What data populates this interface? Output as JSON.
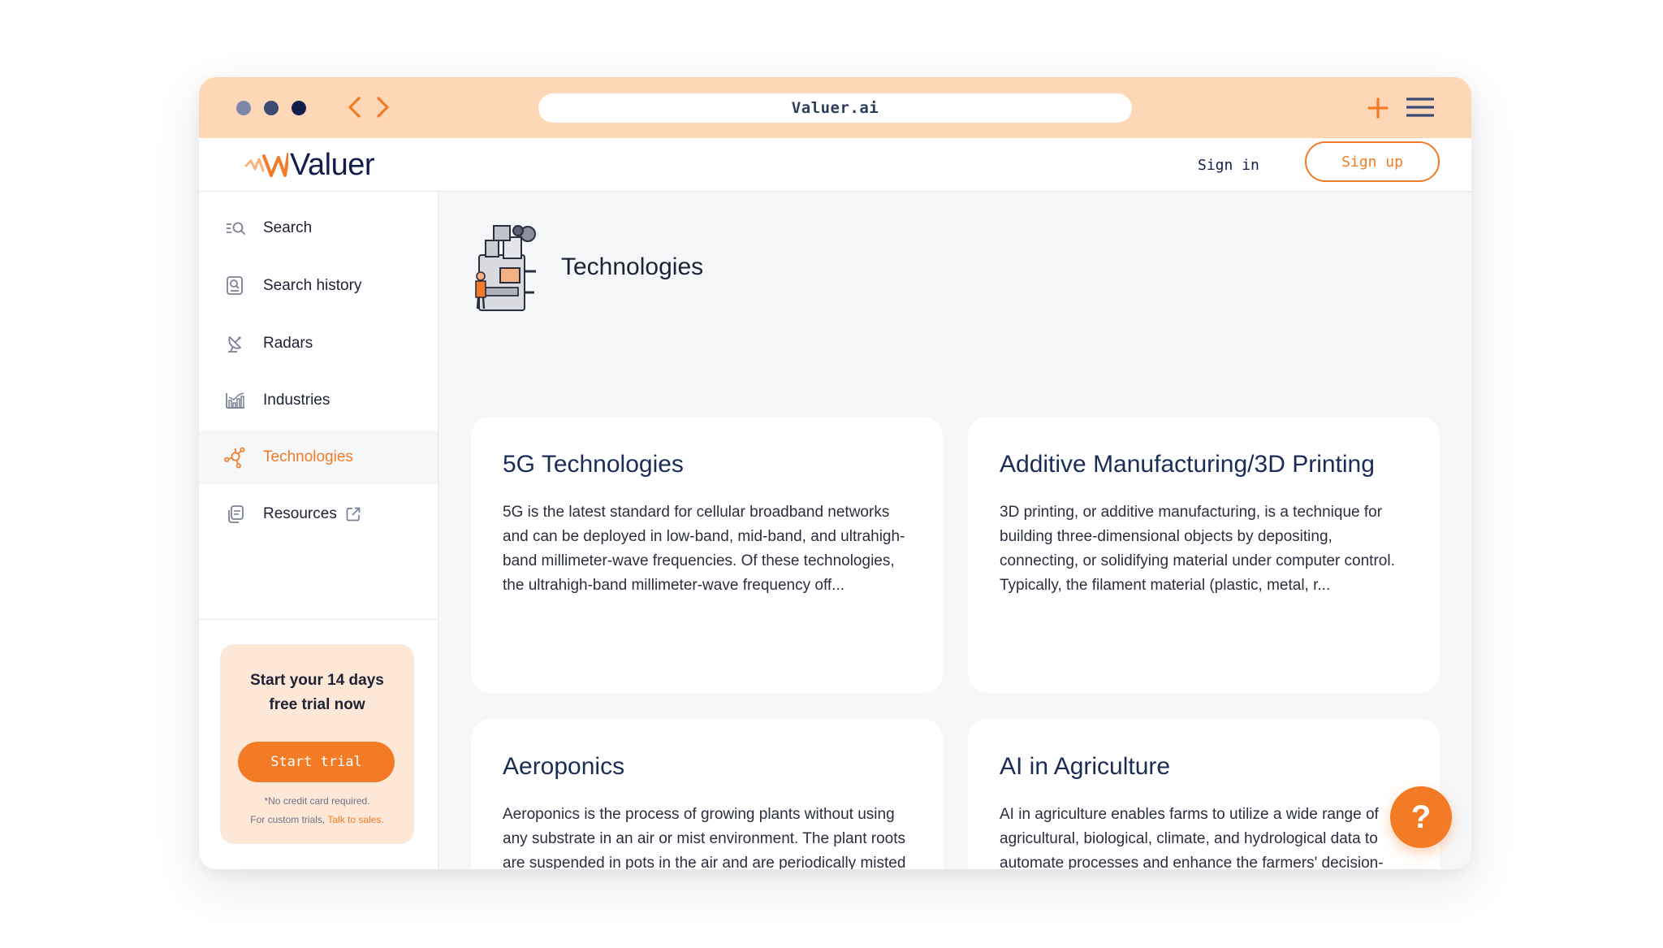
{
  "browser": {
    "url": "Valuer.ai",
    "colors": {
      "chrome": "#fdd7b6",
      "dots": [
        "#7f87a8",
        "#3d4a74",
        "#131d4b"
      ],
      "accent": "#f47b25"
    }
  },
  "header": {
    "logo_text": "Valuer",
    "sign_in": "Sign in",
    "sign_up": "Sign up"
  },
  "sidebar": {
    "items": [
      {
        "label": "Search",
        "icon": "search-list-icon"
      },
      {
        "label": "Search history",
        "icon": "history-doc-icon"
      },
      {
        "label": "Radars",
        "icon": "radar-dish-icon"
      },
      {
        "label": "Industries",
        "icon": "bar-chart-icon"
      },
      {
        "label": "Technologies",
        "icon": "network-nodes-icon",
        "active": true
      },
      {
        "label": "Resources",
        "icon": "stacked-docs-icon",
        "external": true
      }
    ],
    "trial": {
      "title": "Start your 14 days\nfree trial now",
      "button": "Start trial",
      "note_line1": "*No credit card required.",
      "note_line2": "For custom trials,",
      "note_link": "Talk to sales."
    }
  },
  "main": {
    "title": "Technologies",
    "cards": [
      {
        "title": "5G Technologies",
        "text": "5G is the latest standard for cellular broadband networks and can be deployed in low-band, mid-band, and ultrahigh-band millimeter-wave frequencies. Of these technologies, the ultrahigh-band millimeter-wave frequency off..."
      },
      {
        "title": "Additive Manufacturing/3D Printing",
        "text": "3D printing, or additive manufacturing, is a technique for building three-dimensional objects by depositing, connecting, or solidifying material under computer control. Typically, the filament material (plastic, metal, r..."
      },
      {
        "title": "Aeroponics",
        "text": "Aeroponics is the process of growing plants without using any substrate in an air or mist environment. The plant roots are suspended in pots in the air and are periodically misted or sprayed with a nutrient solution. One..."
      },
      {
        "title": "AI in Agriculture",
        "text": "AI in agriculture enables farms to utilize a wide range of agricultural, biological, climate, and hydrological data to automate processes and enhance the farmers' decision-making. It can help to improve harvest quality a..."
      }
    ],
    "help_label": "?"
  }
}
